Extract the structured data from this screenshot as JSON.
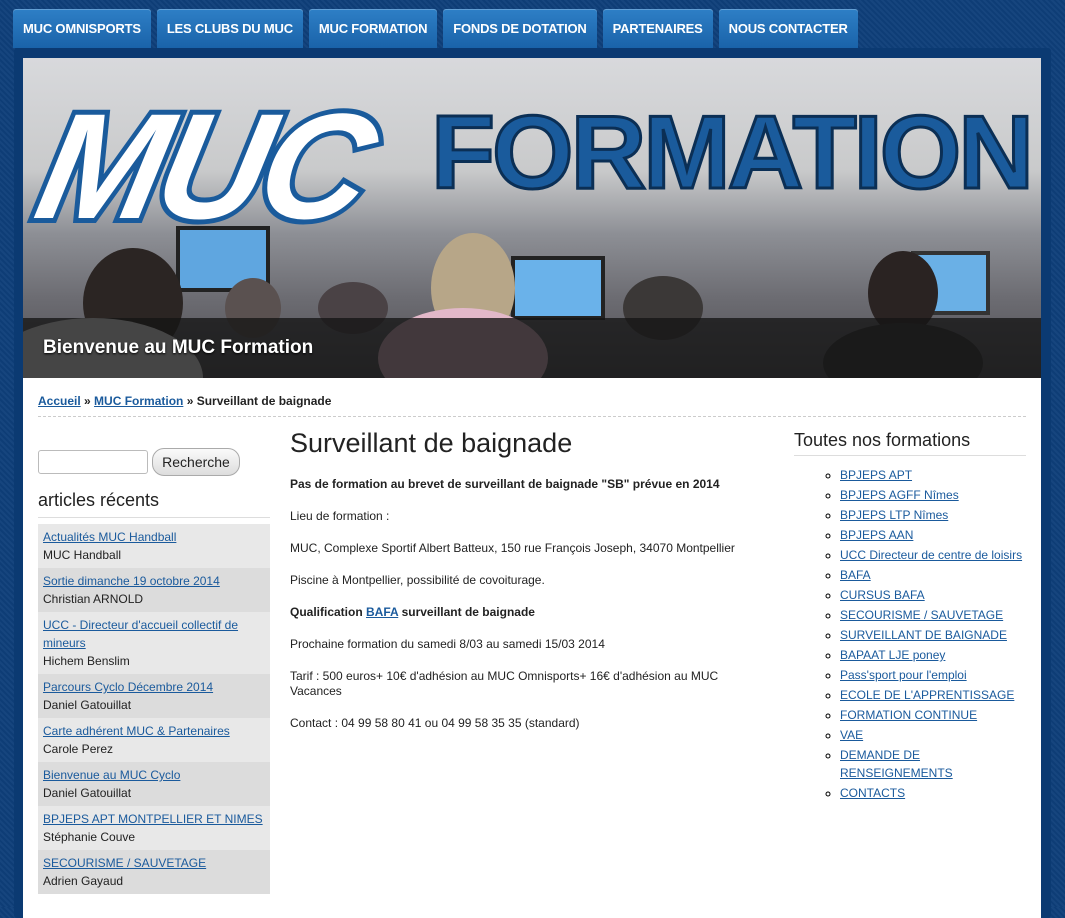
{
  "nav": {
    "tabs": [
      "MUC OMNISPORTS",
      "LES CLUBS DU MUC",
      "MUC FORMATION",
      "FONDS DE DOTATION",
      "PARTENAIRES",
      "NOUS CONTACTER"
    ]
  },
  "banner": {
    "logo_left": "MUC",
    "logo_right": "FORMATION",
    "welcome": "Bienvenue au MUC Formation"
  },
  "breadcrumb": {
    "home": "Accueil",
    "sep1": " » ",
    "section": "MUC Formation",
    "sep2": " » ",
    "current": "Surveillant de baignade"
  },
  "search": {
    "button": "Recherche",
    "value": ""
  },
  "recent": {
    "title": "articles récents",
    "items": [
      {
        "title": "Actualités MUC Handball",
        "author": "MUC Handball"
      },
      {
        "title": "Sortie dimanche 19 octobre 2014",
        "author": "Christian ARNOLD"
      },
      {
        "title": "UCC - Directeur d'accueil collectif de mineurs",
        "author": "Hichem Benslim"
      },
      {
        "title": "Parcours Cyclo Décembre 2014",
        "author": "Daniel Gatouillat"
      },
      {
        "title": "Carte adhérent MUC & Partenaires",
        "author": "Carole Perez"
      },
      {
        "title": "Bienvenue au MUC Cyclo",
        "author": "Daniel Gatouillat"
      },
      {
        "title": "BPJEPS APT MONTPELLIER ET NIMES",
        "author": "Stéphanie Couve"
      },
      {
        "title": "SECOURISME / SAUVETAGE",
        "author": "Adrien Gayaud"
      }
    ]
  },
  "main": {
    "title": "Surveillant de baignade",
    "p1": "Pas de formation au brevet de surveillant de baignade \"SB\" prévue en 2014",
    "p2": "Lieu de formation :",
    "p3": "MUC, Complexe Sportif Albert Batteux, 150 rue François Joseph, 34070 Montpellier",
    "p4": "Piscine à Montpellier, possibilité de covoiturage.",
    "p5_pre": "Qualification ",
    "p5_link": "BAFA",
    "p5_post": " surveillant de baignade",
    "p6": "Prochaine formation du samedi 8/03 au samedi 15/03 2014",
    "p7": "Tarif : 500 euros+ 10€ d'adhésion au MUC Omnisports+ 16€ d'adhésion au MUC Vacances",
    "p8": "Contact : 04 99 58 80 41 ou 04 99 58 35 35 (standard)"
  },
  "formations": {
    "title": "Toutes nos formations",
    "items": [
      "BPJEPS APT",
      "BPJEPS AGFF Nîmes",
      "BPJEPS LTP Nîmes",
      "BPJEPS AAN",
      "UCC Directeur de centre de loisirs",
      "BAFA",
      "CURSUS BAFA",
      "SECOURISME / SAUVETAGE",
      "SURVEILLANT DE BAIGNADE",
      "BAPAAT LJE poney",
      "Pass'sport pour l'emploi",
      "ECOLE DE L'APPRENTISSAGE",
      "FORMATION CONTINUE",
      "VAE",
      "DEMANDE DE RENSEIGNEMENTS",
      "CONTACTS"
    ]
  }
}
